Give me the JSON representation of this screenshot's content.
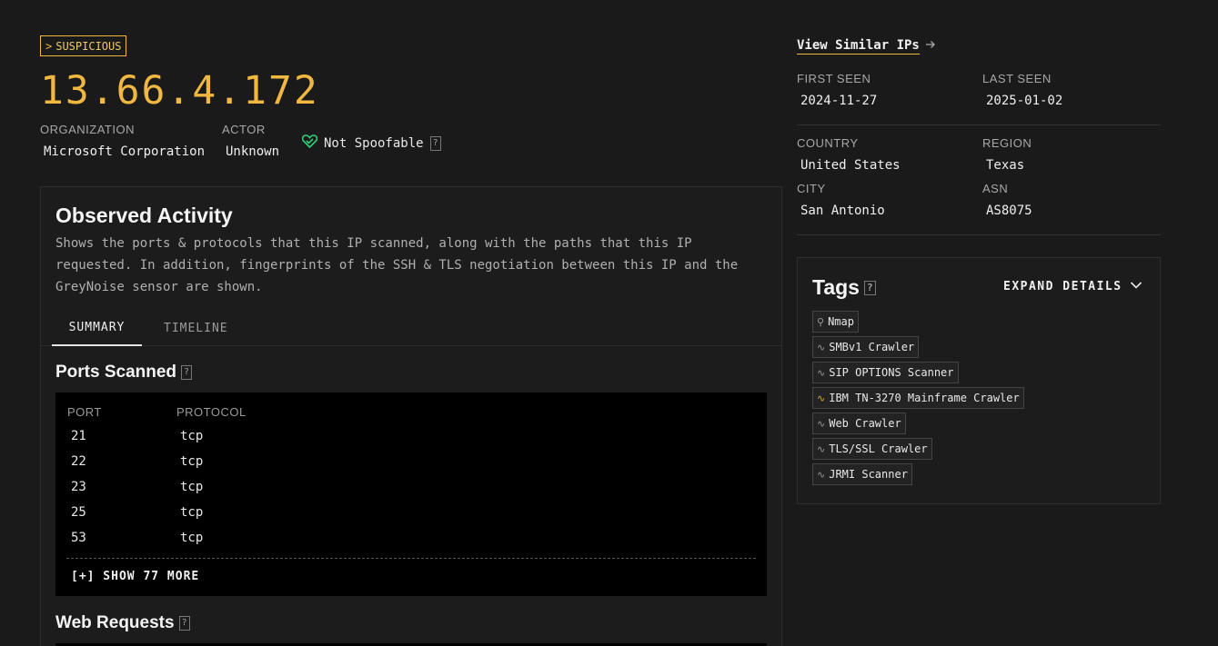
{
  "header": {
    "classification": "SUSPICIOUS",
    "classification_prefix": ">",
    "ip": "13.66.4.172",
    "organization_label": "ORGANIZATION",
    "organization_value": "Microsoft Corporation",
    "actor_label": "ACTOR",
    "actor_value": "Unknown",
    "spoofable_text": "Not Spoofable",
    "help_glyph": "?"
  },
  "observed_activity": {
    "title": "Observed Activity",
    "description": "Shows the ports & protocols that this IP scanned, along with the paths that this IP requested. In addition, fingerprints of the SSH & TLS negotiation between this IP and the GreyNoise sensor are shown.",
    "tabs": [
      "SUMMARY",
      "TIMELINE"
    ],
    "active_tab": "SUMMARY",
    "ports_title": "Ports Scanned",
    "ports_headers": [
      "PORT",
      "PROTOCOL"
    ],
    "ports_rows": [
      {
        "port": "21",
        "protocol": "tcp"
      },
      {
        "port": "22",
        "protocol": "tcp"
      },
      {
        "port": "23",
        "protocol": "tcp"
      },
      {
        "port": "25",
        "protocol": "tcp"
      },
      {
        "port": "53",
        "protocol": "tcp"
      }
    ],
    "show_more": "[+] SHOW 77 MORE",
    "web_requests_title": "Web Requests"
  },
  "details": {
    "view_similar": "View Similar IPs",
    "first_seen_label": "FIRST SEEN",
    "first_seen": "2024-11-27",
    "last_seen_label": "LAST SEEN",
    "last_seen": "2025-01-02",
    "country_label": "COUNTRY",
    "country": "United States",
    "region_label": "REGION",
    "region": "Texas",
    "city_label": "CITY",
    "city": "San Antonio",
    "asn_label": "ASN",
    "asn": "AS8075"
  },
  "tags": {
    "title": "Tags",
    "expand_label": "EXPAND DETAILS",
    "items": [
      {
        "label": "Nmap",
        "icon": "wrench-icon"
      },
      {
        "label": "SMBv1 Crawler",
        "icon": "activity-icon"
      },
      {
        "label": "SIP OPTIONS Scanner",
        "icon": "activity-icon"
      },
      {
        "label": "IBM TN-3270 Mainframe Crawler",
        "icon": "activity-icon-highlight"
      },
      {
        "label": "Web Crawler",
        "icon": "activity-icon"
      },
      {
        "label": "TLS/SSL Crawler",
        "icon": "activity-icon"
      },
      {
        "label": "JRMI Scanner",
        "icon": "activity-icon"
      }
    ]
  },
  "colors": {
    "accent": "#f0b840",
    "background": "#1a1a1a",
    "panel": "#1c1c1c",
    "heart": "#2fd27a"
  }
}
